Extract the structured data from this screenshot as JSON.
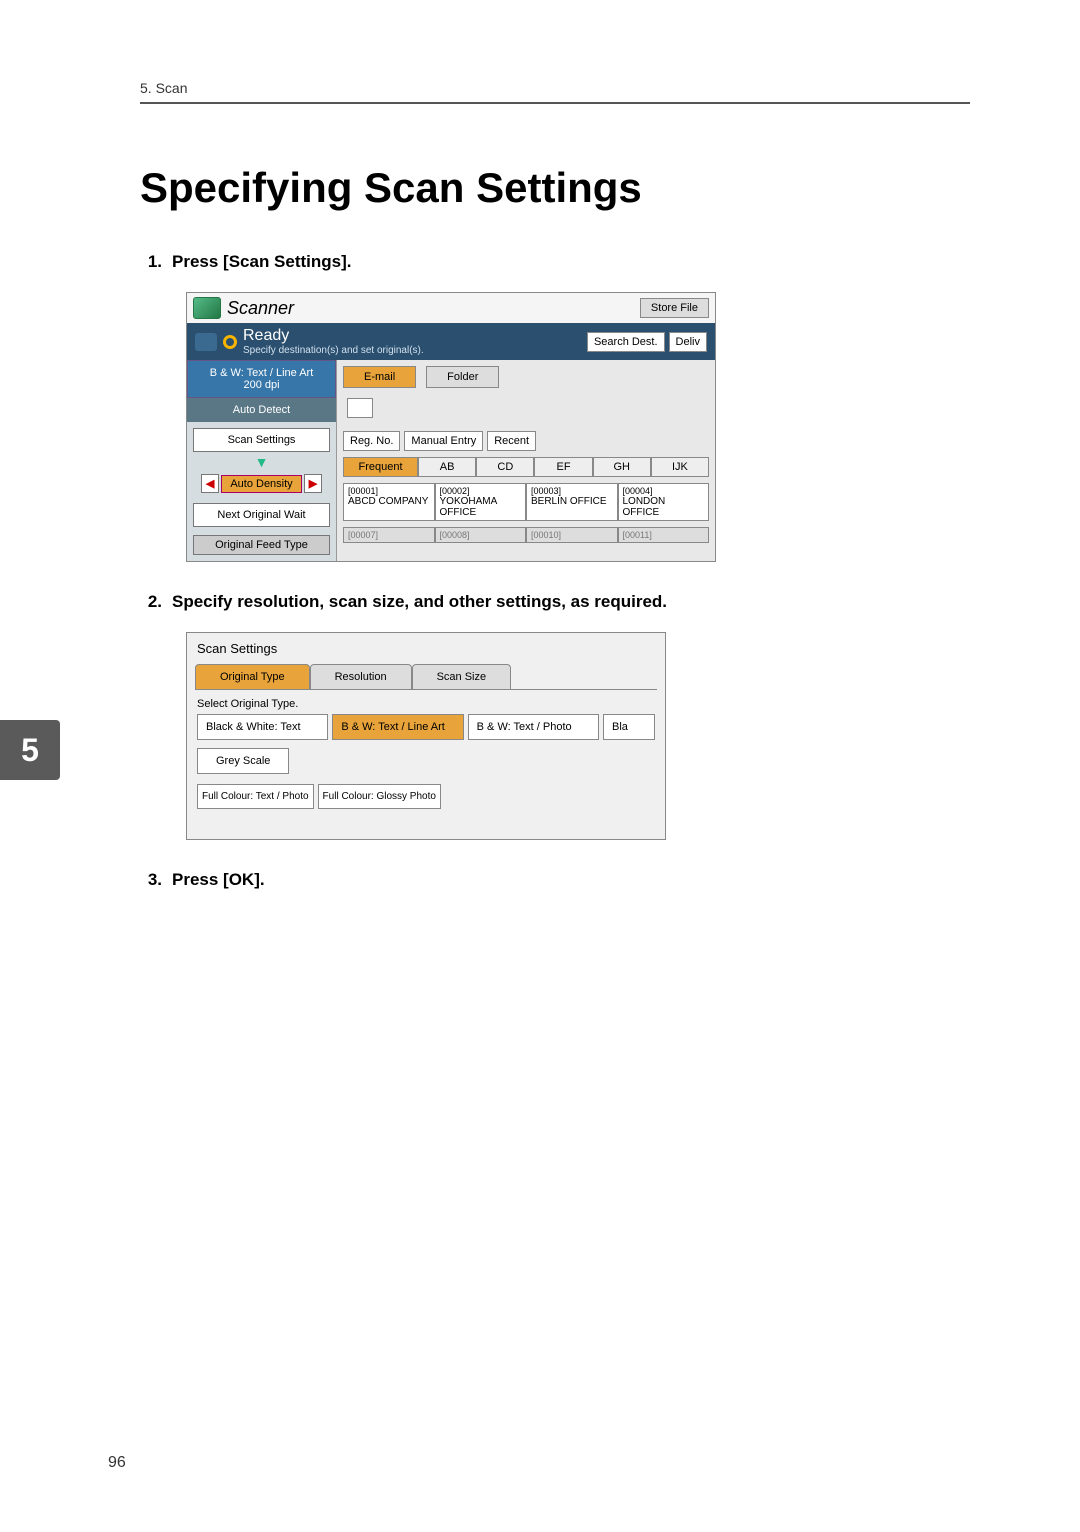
{
  "header": {
    "section": "5. Scan"
  },
  "title": "Specifying Scan Settings",
  "sidebar_chapter": "5",
  "page_number": "96",
  "steps": {
    "s1": {
      "num": "1.",
      "text": "Press [Scan Settings]."
    },
    "s2": {
      "num": "2.",
      "text": "Specify resolution, scan size, and other settings, as required."
    },
    "s3": {
      "num": "3.",
      "text": "Press [OK]."
    }
  },
  "shot1": {
    "scanner_label": "Scanner",
    "store_file": "Store File",
    "ready": "Ready",
    "ready_sub": "Specify destination(s) and set original(s).",
    "search_dest": "Search Dest.",
    "deliv": "Deliv",
    "bw_line1": "B & W: Text / Line Art",
    "bw_line2": "200 dpi",
    "auto_detect": "Auto Detect",
    "scan_settings": "Scan Settings",
    "auto_density": "Auto Density",
    "next_original": "Next Original Wait",
    "original_feed": "Original Feed Type",
    "tab_email": "E-mail",
    "tab_folder": "Folder",
    "reg_no": "Reg. No.",
    "manual_entry": "Manual Entry",
    "recent": "Recent",
    "alpha": {
      "freq": "Frequent",
      "a": "AB",
      "b": "CD",
      "c": "EF",
      "d": "GH",
      "e": "IJK"
    },
    "dest": [
      {
        "n": "[00001]",
        "name": "ABCD COMPANY"
      },
      {
        "n": "[00002]",
        "name": "YOKOHAMA OFFICE"
      },
      {
        "n": "[00003]",
        "name": "BERLIN OFFICE"
      },
      {
        "n": "[00004]",
        "name": "LONDON OFFICE"
      }
    ],
    "dest2": [
      {
        "n": "[00007]"
      },
      {
        "n": "[00008]"
      },
      {
        "n": "[00010]"
      },
      {
        "n": "[00011]"
      }
    ]
  },
  "shot2": {
    "title": "Scan Settings",
    "tab_type": "Original Type",
    "tab_res": "Resolution",
    "tab_size": "Scan Size",
    "select_label": "Select Original Type.",
    "bw_text": "Black & White: Text",
    "bw_line": "B & W: Text / Line Art",
    "bw_photo": "B & W: Text / Photo",
    "bla": "Bla",
    "grey": "Grey Scale",
    "fc_text": "Full Colour: Text / Photo",
    "fc_glossy": "Full Colour: Glossy Photo"
  }
}
